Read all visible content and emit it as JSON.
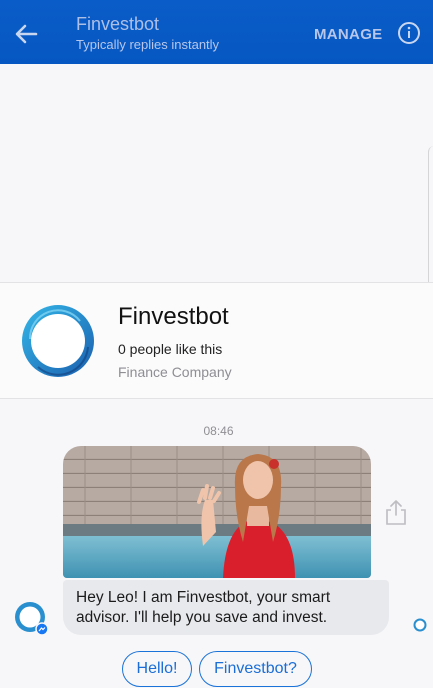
{
  "header": {
    "title": "Finvestbot",
    "subtitle": "Typically replies instantly",
    "manage_label": "MANAGE"
  },
  "page_card": {
    "name": "Finvestbot",
    "likes": "0 people like this",
    "category": "Finance Company"
  },
  "conversation": {
    "timestamp": "08:46",
    "message": "Hey Leo! I am Finvestbot, your smart advisor. I'll help you save and invest."
  },
  "quick_replies": [
    "Hello!",
    "Finvestbot?"
  ],
  "colors": {
    "header_bg": "#0657c1",
    "accent": "#1a73d9",
    "bubble_bg": "#e8e9ed"
  },
  "icons": [
    "back-arrow-icon",
    "info-icon",
    "share-icon",
    "messenger-badge-icon",
    "read-receipt-icon"
  ]
}
